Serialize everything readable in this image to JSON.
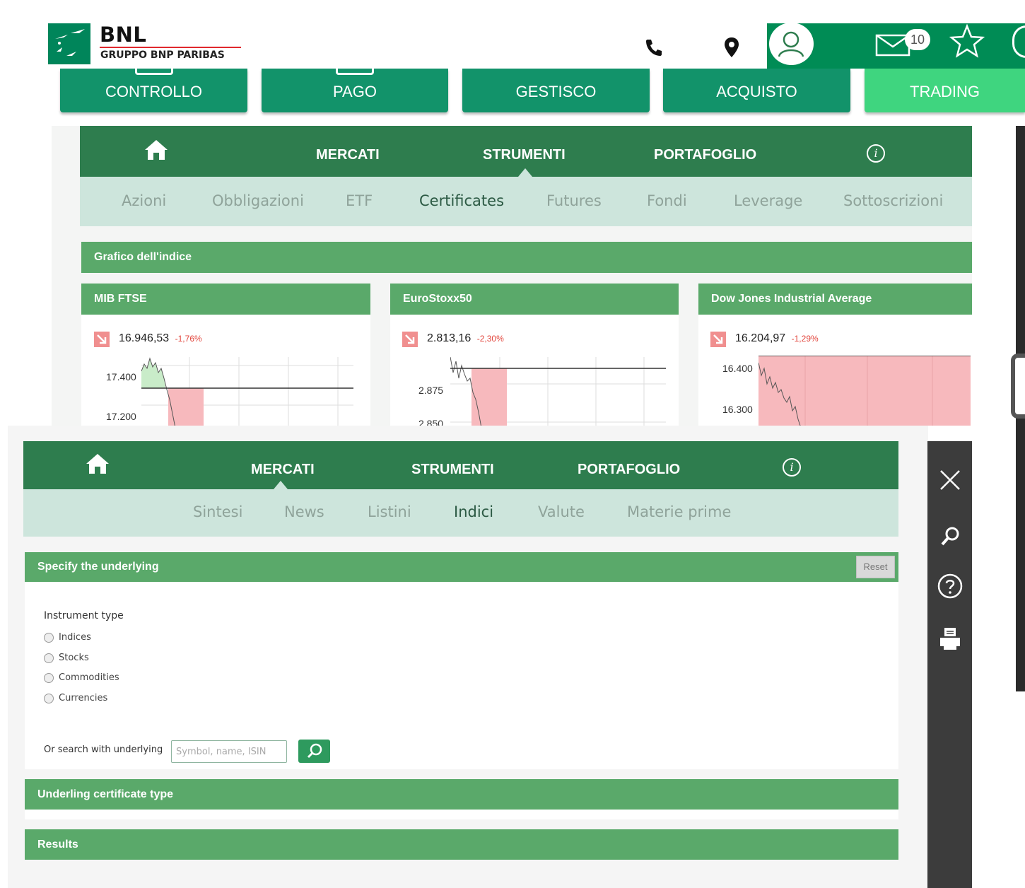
{
  "header": {
    "brand": "BNL",
    "brand_sub": "GRUPPO BNP PARIBAS",
    "notifications_count": "10",
    "icons": [
      "phone-icon",
      "location-pin-icon",
      "user-icon",
      "mail-icon",
      "star-icon"
    ]
  },
  "main_tabs": [
    {
      "label": "CONTROLLO"
    },
    {
      "label": "PAGO"
    },
    {
      "label": "GESTISCO"
    },
    {
      "label": "ACQUISTO"
    },
    {
      "label": "TRADING",
      "active": true
    }
  ],
  "top_nav": {
    "items": [
      "MERCATI",
      "STRUMENTI",
      "PORTAFOGLIO"
    ],
    "active": "STRUMENTI"
  },
  "top_subnav": {
    "items": [
      "Azioni",
      "Obbligazioni",
      "ETF",
      "Certificates",
      "Futures",
      "Fondi",
      "Leverage",
      "Sottoscrizioni"
    ],
    "active": "Certificates"
  },
  "index_chart": {
    "title": "Grafico dell'indice",
    "cards": [
      {
        "name": "MIB FTSE",
        "value": "16.946,53",
        "change": "-1,76%",
        "ticks": [
          "17.400",
          "17.200"
        ]
      },
      {
        "name": "EuroStoxx50",
        "value": "2.813,16",
        "change": "-2,30%",
        "ticks": [
          "2.875",
          "2.850"
        ]
      },
      {
        "name": "Dow Jones Industrial Average",
        "value": "16.204,97",
        "change": "-1,29%",
        "ticks": [
          "16.400",
          "16.300"
        ]
      }
    ]
  },
  "low_nav": {
    "items": [
      "MERCATI",
      "STRUMENTI",
      "PORTAFOGLIO"
    ],
    "active": "MERCATI"
  },
  "low_subnav": {
    "items": [
      "Sintesi",
      "News",
      "Listini",
      "Indici",
      "Valute",
      "Materie prime"
    ],
    "active": "Indici"
  },
  "specify": {
    "title": "Specify the underlying",
    "reset_label": "Reset",
    "instrument_type_label": "Instrument type",
    "options": [
      "Indices",
      "Stocks",
      "Commodities",
      "Currencies"
    ],
    "search_label": "Or search with underlying",
    "search_placeholder": "Symbol, name, ISIN"
  },
  "sections": {
    "underlying_type": "Underling certificate type",
    "results": "Results"
  },
  "colors": {
    "brand_green": "#008c55",
    "nav_dark": "#2e7d4e",
    "section_green": "#5aa96a",
    "down_red": "#e2453c",
    "subnav_bg": "#cde5dc"
  }
}
